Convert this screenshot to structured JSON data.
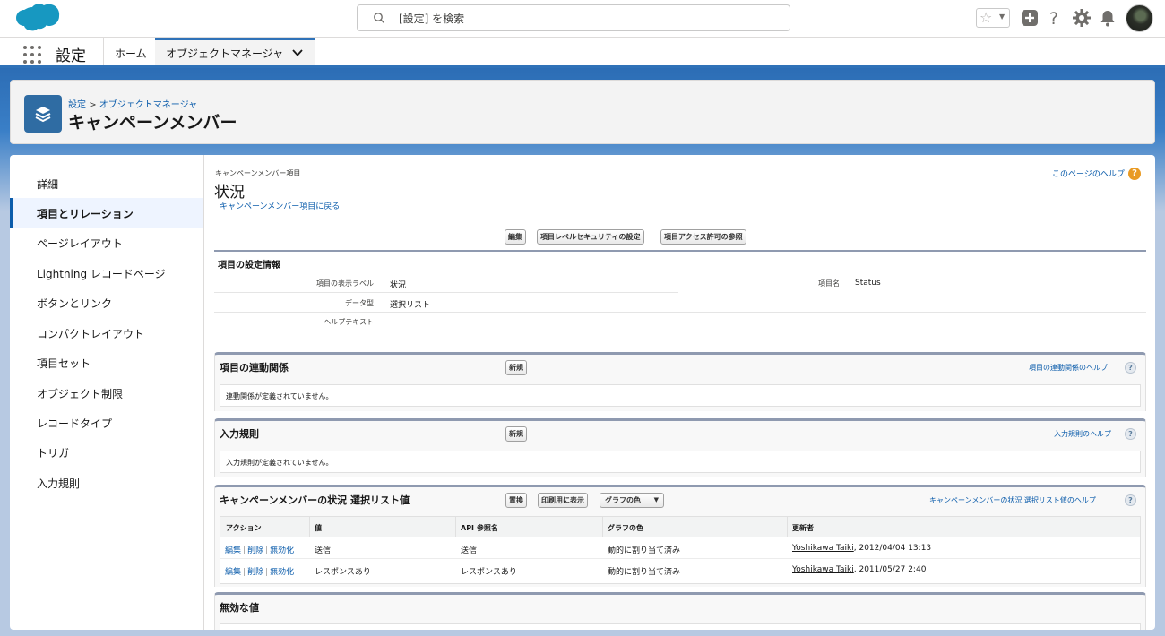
{
  "header": {
    "search_placeholder": "[設定] を検索"
  },
  "nav": {
    "app_name": "設定",
    "tabs": [
      {
        "label": "ホーム"
      },
      {
        "label": "オブジェクトマネージャ"
      }
    ]
  },
  "page_header": {
    "breadcrumb": {
      "root": "設定",
      "separator": ">",
      "current": "オブジェクトマネージャ"
    },
    "title": "キャンペーンメンバー"
  },
  "sidebar": {
    "items": [
      {
        "label": "詳細"
      },
      {
        "label": "項目とリレーション",
        "active": true
      },
      {
        "label": "ページレイアウト"
      },
      {
        "label": "Lightning レコードページ"
      },
      {
        "label": "ボタンとリンク"
      },
      {
        "label": "コンパクトレイアウト"
      },
      {
        "label": "項目セット"
      },
      {
        "label": "オブジェクト制限"
      },
      {
        "label": "レコードタイプ"
      },
      {
        "label": "トリガ"
      },
      {
        "label": "入力規則"
      }
    ]
  },
  "content": {
    "subtitle": "キャンペーンメンバー項目",
    "title": "状況",
    "back_link": "キャンペーンメンバー項目に戻る",
    "page_help": "このページのヘルプ",
    "buttons": {
      "edit": "編集",
      "field_security": "項目レベルセキュリティの設定",
      "field_access": "項目アクセス許可の参照"
    },
    "definition": {
      "section_title": "項目の設定情報",
      "label_label": "項目の表示ラベル",
      "label_value": "状況",
      "type_label": "データ型",
      "type_value": "選択リスト",
      "help_label": "ヘルプテキスト",
      "help_value": "",
      "name_label": "項目名",
      "name_value": "Status"
    },
    "dependencies": {
      "title": "項目の連動関係",
      "new_button": "新規",
      "help": "項目の連動関係のヘルプ",
      "empty": "連動関係が定義されていません。"
    },
    "validation": {
      "title": "入力規則",
      "new_button": "新規",
      "help": "入力規則のヘルプ",
      "empty": "入力規則が定義されていません。"
    },
    "picklist": {
      "title": "キャンペーンメンバーの状況 選択リスト値",
      "replace_button": "置換",
      "print_button": "印刷用に表示",
      "chart_color_button": "グラフの色",
      "help": "キャンペーンメンバーの状況 選択リスト値のヘルプ",
      "columns": [
        "アクション",
        "値",
        "API 参照名",
        "グラフの色",
        "更新者"
      ],
      "actions": {
        "edit": "編集",
        "delete": "削除",
        "deactivate": "無効化",
        "sep": "|"
      },
      "rows": [
        {
          "value": "送信",
          "api_name": "送信",
          "chart_color": "動的に割り当て済み",
          "modified_by_name": "Yoshikawa Taiki",
          "modified_by_date": ", 2012/04/04 13:13"
        },
        {
          "value": "レスポンスあり",
          "api_name": "レスポンスあり",
          "chart_color": "動的に割り当て済み",
          "modified_by_name": "Yoshikawa Taiki",
          "modified_by_date": ", 2011/05/27 2:40"
        }
      ]
    },
    "inactive": {
      "title": "無効な値"
    },
    "help_glyph": "?"
  },
  "colors": {
    "brand_blue": "#2f72b8",
    "link": "#0b5cab",
    "logo": "#1798c1"
  }
}
